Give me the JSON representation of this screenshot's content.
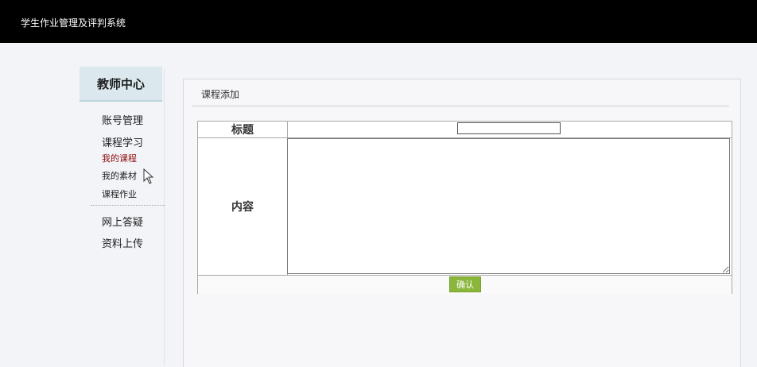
{
  "app": {
    "title": "学生作业管理及评判系统"
  },
  "sidebar": {
    "header": "教师中心",
    "items": [
      {
        "label": "账号管理"
      },
      {
        "label": "课程学习"
      },
      {
        "label": "网上答疑"
      },
      {
        "label": "资料上传"
      }
    ],
    "subitems": [
      {
        "label": "我的课程",
        "active": true
      },
      {
        "label": "我的素材",
        "active": false
      },
      {
        "label": "课程作业",
        "active": false
      }
    ]
  },
  "panel": {
    "title": "课程添加",
    "form": {
      "title_label": "标题",
      "title_value": "",
      "content_label": "内容",
      "content_value": "",
      "submit_label": "确认"
    }
  },
  "colors": {
    "topbar": "#000000",
    "sidebar_header": "#dbe9ef",
    "active_link": "#8b0d0d",
    "confirm_button": "#8ab63c"
  }
}
